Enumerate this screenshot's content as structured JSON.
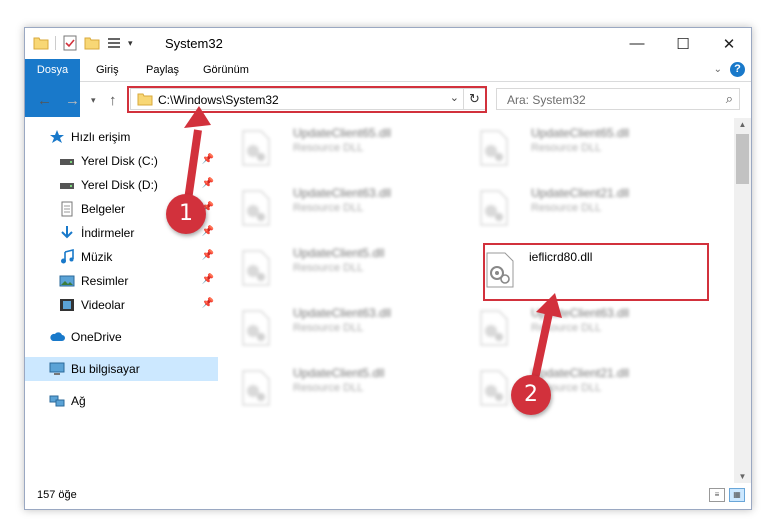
{
  "window": {
    "title": "System32",
    "controls": {
      "minimize": "—",
      "maximize": "☐",
      "close": "✕"
    }
  },
  "ribbon": {
    "tabs": [
      "Dosya",
      "Giriş",
      "Paylaş",
      "Görünüm"
    ]
  },
  "nav": {
    "address": "C:\\Windows\\System32",
    "search_placeholder": "Ara: System32"
  },
  "sidebar": {
    "items": [
      {
        "label": "Hızlı erişim",
        "icon": "star-icon"
      },
      {
        "label": "Yerel Disk (C:)",
        "icon": "drive-icon",
        "pinned": true
      },
      {
        "label": "Yerel Disk (D:)",
        "icon": "drive-icon",
        "pinned": true
      },
      {
        "label": "Belgeler",
        "icon": "documents-icon",
        "pinned": true
      },
      {
        "label": "İndirmeler",
        "icon": "download-icon",
        "pinned": true
      },
      {
        "label": "Müzik",
        "icon": "music-icon",
        "pinned": true
      },
      {
        "label": "Resimler",
        "icon": "pictures-icon",
        "pinned": true
      },
      {
        "label": "Videolar",
        "icon": "videos-icon",
        "pinned": true
      },
      {
        "label": "OneDrive",
        "icon": "cloud-icon"
      },
      {
        "label": "Bu bilgisayar",
        "icon": "computer-icon",
        "selected": true
      },
      {
        "label": "Ağ",
        "icon": "network-icon"
      }
    ]
  },
  "files": [
    {
      "name": "UpdateClient65.dll",
      "desc": "Resource DLL"
    },
    {
      "name": "UpdateClient65.dll",
      "desc": "Resource DLL"
    },
    {
      "name": "UpdateClient63.dll",
      "desc": "Resource DLL"
    },
    {
      "name": "UpdateClient21.dll",
      "desc": "Resource DLL"
    },
    {
      "name": "UpdateClient5.dll",
      "desc": "Resource DLL"
    },
    {
      "name": "ieflicrd80.dll",
      "desc": ""
    },
    {
      "name": "UpdateClient63.dll",
      "desc": "Resource DLL"
    },
    {
      "name": "UpdateClient63.dll",
      "desc": "Resource DLL"
    },
    {
      "name": "UpdateClient5.dll",
      "desc": "Resource DLL"
    },
    {
      "name": "UpdateClient21.dll",
      "desc": "Resource DLL"
    }
  ],
  "status": {
    "count": "157 öğe"
  },
  "annotations": {
    "step1": "1",
    "step2": "2"
  },
  "colors": {
    "accent": "#1979ca",
    "annotation": "#d2313c",
    "selected": "#cce8ff"
  }
}
